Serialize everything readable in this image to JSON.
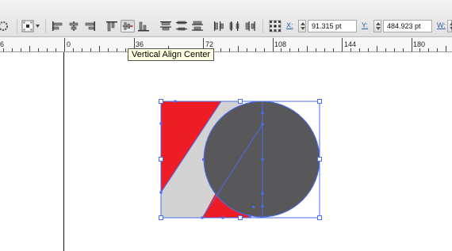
{
  "toolbar": {
    "align_buttons": [
      {
        "name": "horizontal-align-left-icon"
      },
      {
        "name": "horizontal-align-center-icon"
      },
      {
        "name": "horizontal-align-right-icon"
      },
      {
        "name": "vertical-align-top-icon"
      },
      {
        "name": "vertical-align-center-icon",
        "pressed": true
      },
      {
        "name": "vertical-align-bottom-icon"
      },
      {
        "name": "vertical-distribute-top-icon"
      },
      {
        "name": "vertical-distribute-center-icon"
      },
      {
        "name": "vertical-distribute-bottom-icon"
      },
      {
        "name": "horizontal-distribute-left-icon"
      },
      {
        "name": "horizontal-distribute-center-icon"
      },
      {
        "name": "horizontal-distribute-right-icon"
      }
    ],
    "x_label": "X:",
    "x_value": "91.315 pt",
    "y_label": "Y:",
    "y_value": "484.923 pt",
    "w_label": "W:"
  },
  "tooltip": {
    "text": "Vertical Align Center"
  },
  "ruler": {
    "labels": [
      "6",
      "0",
      "36",
      "72",
      "108",
      "144",
      "180"
    ]
  },
  "colors": {
    "red": "#ee1c24",
    "gray": "#d3d3d3",
    "circle": "#58585a",
    "selection": "#4a6cf0"
  }
}
